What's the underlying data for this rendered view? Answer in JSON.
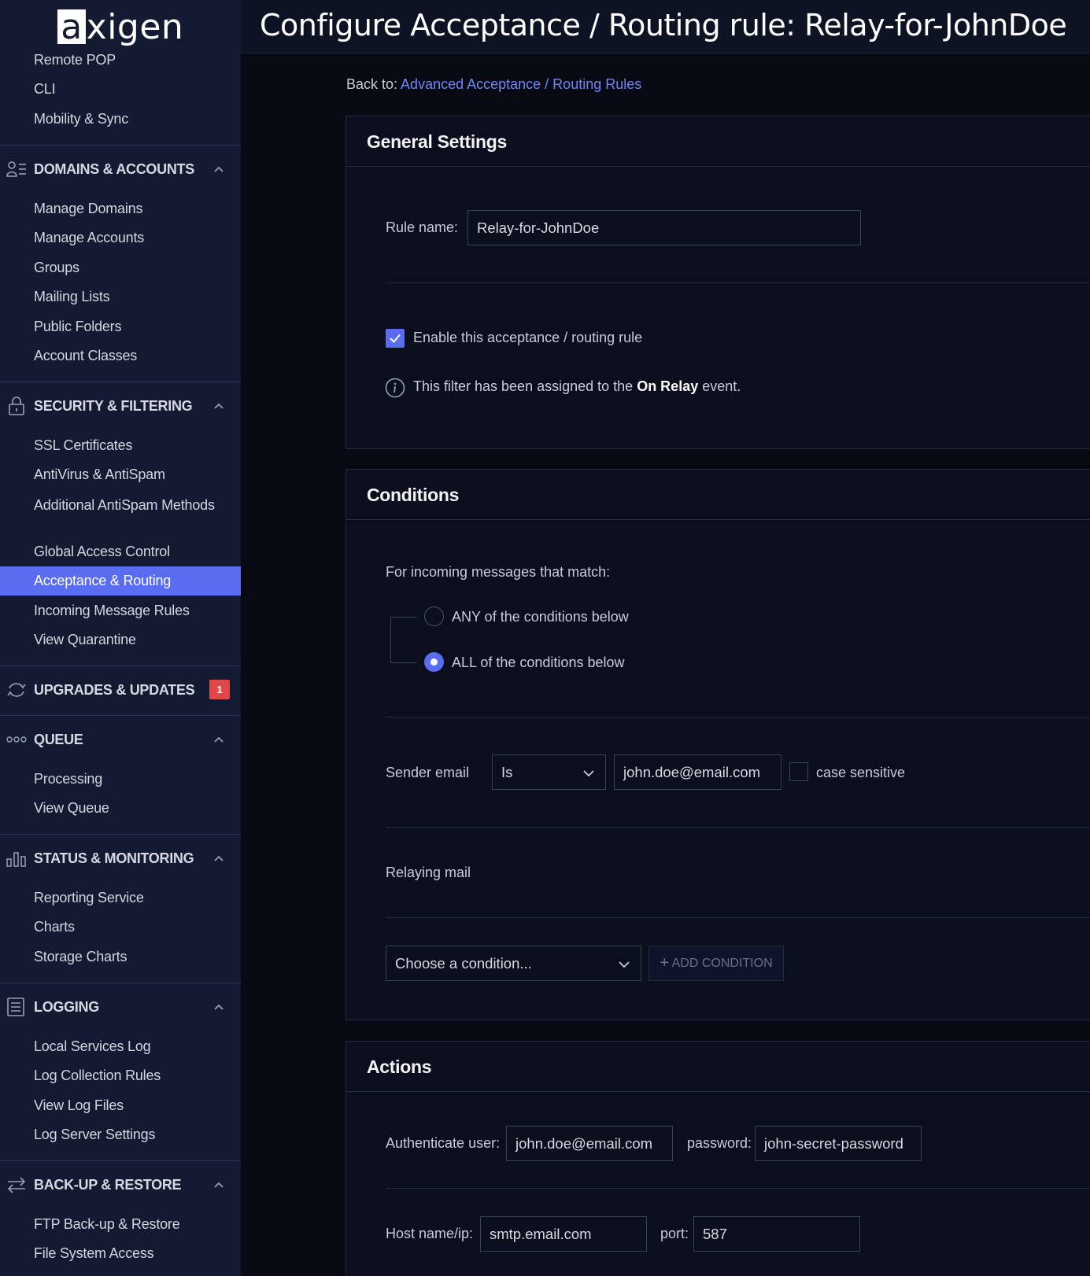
{
  "brand": {
    "logo_mark": "a",
    "logo_word": "xigen"
  },
  "header": {
    "title": "Configure Acceptance / Routing rule: Relay-for-JohnDoe"
  },
  "sidebar": {
    "top_items": [
      "Remote POP",
      "CLI",
      "Mobility & Sync"
    ],
    "sections": [
      {
        "title": "DOMAINS & ACCOUNTS",
        "icon": "users-list-icon",
        "items": [
          "Manage Domains",
          "Manage Accounts",
          "Groups",
          "Mailing Lists",
          "Public Folders",
          "Account Classes"
        ]
      },
      {
        "title": "SECURITY & FILTERING",
        "icon": "lock-icon",
        "items": [
          "SSL Certificates",
          "AntiVirus & AntiSpam",
          "Additional AntiSpam Methods",
          "Global Access Control",
          "Acceptance & Routing",
          "Incoming Message Rules",
          "View Quarantine"
        ],
        "active": "Acceptance & Routing"
      },
      {
        "title": "UPGRADES & UPDATES",
        "icon": "refresh-icon",
        "badge": "1"
      },
      {
        "title": "QUEUE",
        "icon": "dots-icon",
        "items": [
          "Processing",
          "View Queue"
        ]
      },
      {
        "title": "STATUS & MONITORING",
        "icon": "bar-chart-icon",
        "items": [
          "Reporting Service",
          "Charts",
          "Storage Charts"
        ]
      },
      {
        "title": "LOGGING",
        "icon": "document-lines-icon",
        "items": [
          "Local Services Log",
          "Log Collection Rules",
          "View Log Files",
          "Log Server Settings"
        ]
      },
      {
        "title": "BACK-UP & RESTORE",
        "icon": "swap-arrows-icon",
        "items": [
          "FTP Back-up & Restore",
          "File System Access"
        ]
      }
    ]
  },
  "backto": {
    "prefix": "Back to:",
    "link": "Advanced Acceptance / Routing Rules"
  },
  "general": {
    "title": "General Settings",
    "rule_name_label": "Rule name:",
    "rule_name_value": "Relay-for-JohnDoe",
    "enable_label": "Enable this acceptance / routing rule",
    "enable_checked": true,
    "info_prefix": "This filter has been assigned to the",
    "info_event": "On Relay",
    "info_suffix": "event."
  },
  "conditions": {
    "title": "Conditions",
    "match_label": "For incoming messages that match:",
    "option_any": "ANY of the conditions below",
    "option_all": "ALL of the conditions below",
    "selected": "ALL",
    "sender_label": "Sender email",
    "sender_operator": "Is",
    "sender_value": "john.doe@email.com",
    "case_sensitive_label": "case sensitive",
    "case_sensitive_checked": false,
    "relaying_label": "Relaying mail",
    "choose_placeholder": "Choose a condition...",
    "add_button": "ADD CONDITION"
  },
  "actions": {
    "title": "Actions",
    "auth_user_label": "Authenticate user:",
    "auth_user_value": "john.doe@email.com",
    "password_label": "password:",
    "password_value": "john-secret-password",
    "host_label": "Host name/ip:",
    "host_value": "smtp.email.com",
    "port_label": "port:",
    "port_value": "587"
  },
  "colors": {
    "accent": "#5a6cf0",
    "link": "#6f86f7",
    "badge": "#e04848",
    "sidebar_bg": "#141a31",
    "page_bg": "#070a13"
  }
}
